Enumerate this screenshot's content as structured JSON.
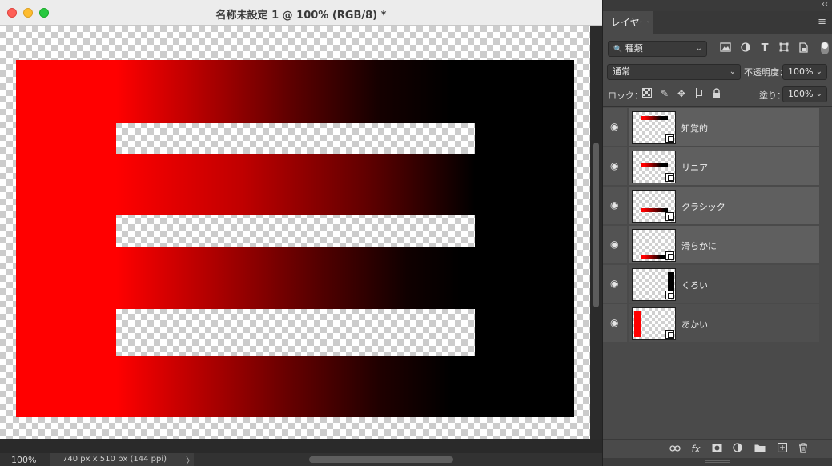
{
  "window": {
    "title": "名称未設定 1 @ 100% (RGB/8) *",
    "traffic_lights": {
      "close": "#fe5f57",
      "minimize": "#febc2e",
      "maximize": "#28c840"
    }
  },
  "status": {
    "zoom": "100%",
    "doc_info": "740 px x 510 px (144 ppi)",
    "arrow": "〉"
  },
  "panel": {
    "collapse_icon": "‹‹",
    "tab_label": "レイヤー",
    "menu_icon": "≡",
    "filter": {
      "value": "種類",
      "search_icon": "🔍",
      "arrow": "⌄"
    },
    "blend_mode": {
      "value": "通常",
      "arrow": "⌄"
    },
    "opacity": {
      "label": "不透明度：",
      "value": "100%",
      "arrow": "⌄"
    },
    "lock": {
      "label": "ロック："
    },
    "fill": {
      "label": "塗り：",
      "value": "100%",
      "arrow": "⌄"
    },
    "layers": [
      {
        "name": "知覚的",
        "visible": true,
        "selected": true
      },
      {
        "name": "リニア",
        "visible": true,
        "selected": true
      },
      {
        "name": "クラシック",
        "visible": true,
        "selected": true
      },
      {
        "name": "滑らかに",
        "visible": true,
        "selected": true
      },
      {
        "name": "くろい",
        "visible": true,
        "selected": false
      },
      {
        "name": "あかい",
        "visible": true,
        "selected": false
      }
    ]
  },
  "colors": {
    "accent_red": "#ff0000",
    "black": "#000000",
    "panel_bg": "#4a4a4a",
    "selected_row": "#5f5f5f"
  }
}
